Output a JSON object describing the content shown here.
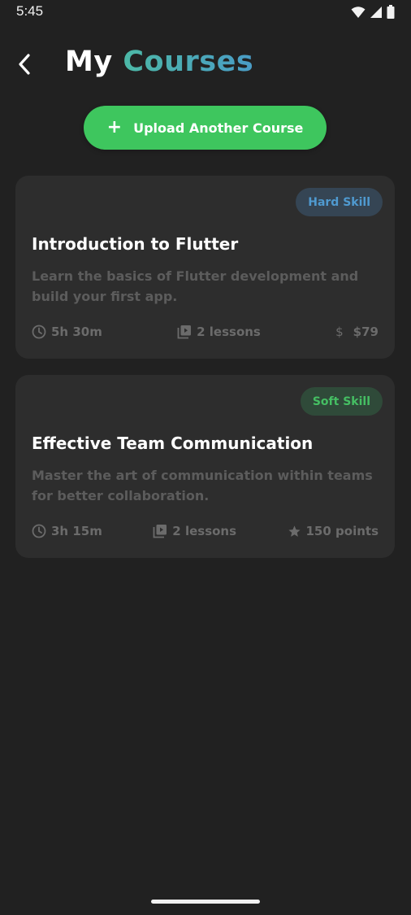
{
  "status_bar": {
    "time": "5:45",
    "icons": [
      "wifi-icon",
      "cell-signal-icon",
      "battery-icon"
    ]
  },
  "header": {
    "back_icon": "back-arrow-icon",
    "title_part1": "My",
    "title_part2": "Courses"
  },
  "upload": {
    "icon": "plus-icon",
    "plus_glyph": "+",
    "label": "Upload Another Course"
  },
  "courses": [
    {
      "badge": "Hard Skill",
      "title": "Introduction to Flutter",
      "description": "Learn the basics of Flutter development and build your first app.",
      "duration": "5h 30m",
      "lessons": "2 lessons",
      "price_symbol": "$",
      "price": "$79"
    },
    {
      "badge": "Soft Skill",
      "title": "Effective Team Communication",
      "description": "Master the art of communication within teams for better collaboration.",
      "duration": "3h 15m",
      "lessons": "2 lessons",
      "points": "150 points"
    }
  ],
  "colors": {
    "background": "#212121",
    "card": "#2d2d2d",
    "upload_button": "#3ec65e",
    "hard_badge_bg": "#354554",
    "hard_badge_text": "#4f9ad0",
    "soft_badge_bg": "#2f4a39",
    "soft_badge_text": "#45bf63",
    "title_gradient_start": "#4cb8a6",
    "title_gradient_end": "#4a9cc6"
  }
}
